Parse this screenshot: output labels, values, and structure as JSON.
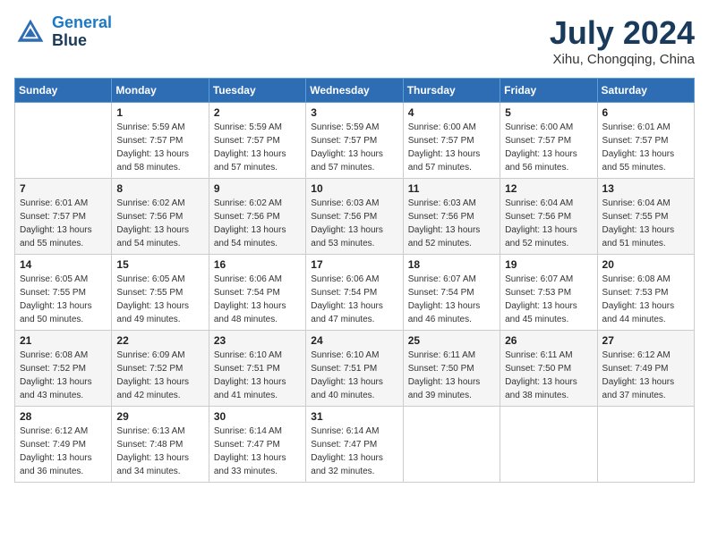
{
  "logo": {
    "line1": "General",
    "line2": "Blue"
  },
  "title": "July 2024",
  "location": "Xihu, Chongqing, China",
  "weekdays": [
    "Sunday",
    "Monday",
    "Tuesday",
    "Wednesday",
    "Thursday",
    "Friday",
    "Saturday"
  ],
  "weeks": [
    [
      {
        "day": "",
        "info": ""
      },
      {
        "day": "1",
        "info": "Sunrise: 5:59 AM\nSunset: 7:57 PM\nDaylight: 13 hours\nand 58 minutes."
      },
      {
        "day": "2",
        "info": "Sunrise: 5:59 AM\nSunset: 7:57 PM\nDaylight: 13 hours\nand 57 minutes."
      },
      {
        "day": "3",
        "info": "Sunrise: 5:59 AM\nSunset: 7:57 PM\nDaylight: 13 hours\nand 57 minutes."
      },
      {
        "day": "4",
        "info": "Sunrise: 6:00 AM\nSunset: 7:57 PM\nDaylight: 13 hours\nand 57 minutes."
      },
      {
        "day": "5",
        "info": "Sunrise: 6:00 AM\nSunset: 7:57 PM\nDaylight: 13 hours\nand 56 minutes."
      },
      {
        "day": "6",
        "info": "Sunrise: 6:01 AM\nSunset: 7:57 PM\nDaylight: 13 hours\nand 55 minutes."
      }
    ],
    [
      {
        "day": "7",
        "info": "Sunrise: 6:01 AM\nSunset: 7:57 PM\nDaylight: 13 hours\nand 55 minutes."
      },
      {
        "day": "8",
        "info": "Sunrise: 6:02 AM\nSunset: 7:56 PM\nDaylight: 13 hours\nand 54 minutes."
      },
      {
        "day": "9",
        "info": "Sunrise: 6:02 AM\nSunset: 7:56 PM\nDaylight: 13 hours\nand 54 minutes."
      },
      {
        "day": "10",
        "info": "Sunrise: 6:03 AM\nSunset: 7:56 PM\nDaylight: 13 hours\nand 53 minutes."
      },
      {
        "day": "11",
        "info": "Sunrise: 6:03 AM\nSunset: 7:56 PM\nDaylight: 13 hours\nand 52 minutes."
      },
      {
        "day": "12",
        "info": "Sunrise: 6:04 AM\nSunset: 7:56 PM\nDaylight: 13 hours\nand 52 minutes."
      },
      {
        "day": "13",
        "info": "Sunrise: 6:04 AM\nSunset: 7:55 PM\nDaylight: 13 hours\nand 51 minutes."
      }
    ],
    [
      {
        "day": "14",
        "info": "Sunrise: 6:05 AM\nSunset: 7:55 PM\nDaylight: 13 hours\nand 50 minutes."
      },
      {
        "day": "15",
        "info": "Sunrise: 6:05 AM\nSunset: 7:55 PM\nDaylight: 13 hours\nand 49 minutes."
      },
      {
        "day": "16",
        "info": "Sunrise: 6:06 AM\nSunset: 7:54 PM\nDaylight: 13 hours\nand 48 minutes."
      },
      {
        "day": "17",
        "info": "Sunrise: 6:06 AM\nSunset: 7:54 PM\nDaylight: 13 hours\nand 47 minutes."
      },
      {
        "day": "18",
        "info": "Sunrise: 6:07 AM\nSunset: 7:54 PM\nDaylight: 13 hours\nand 46 minutes."
      },
      {
        "day": "19",
        "info": "Sunrise: 6:07 AM\nSunset: 7:53 PM\nDaylight: 13 hours\nand 45 minutes."
      },
      {
        "day": "20",
        "info": "Sunrise: 6:08 AM\nSunset: 7:53 PM\nDaylight: 13 hours\nand 44 minutes."
      }
    ],
    [
      {
        "day": "21",
        "info": "Sunrise: 6:08 AM\nSunset: 7:52 PM\nDaylight: 13 hours\nand 43 minutes."
      },
      {
        "day": "22",
        "info": "Sunrise: 6:09 AM\nSunset: 7:52 PM\nDaylight: 13 hours\nand 42 minutes."
      },
      {
        "day": "23",
        "info": "Sunrise: 6:10 AM\nSunset: 7:51 PM\nDaylight: 13 hours\nand 41 minutes."
      },
      {
        "day": "24",
        "info": "Sunrise: 6:10 AM\nSunset: 7:51 PM\nDaylight: 13 hours\nand 40 minutes."
      },
      {
        "day": "25",
        "info": "Sunrise: 6:11 AM\nSunset: 7:50 PM\nDaylight: 13 hours\nand 39 minutes."
      },
      {
        "day": "26",
        "info": "Sunrise: 6:11 AM\nSunset: 7:50 PM\nDaylight: 13 hours\nand 38 minutes."
      },
      {
        "day": "27",
        "info": "Sunrise: 6:12 AM\nSunset: 7:49 PM\nDaylight: 13 hours\nand 37 minutes."
      }
    ],
    [
      {
        "day": "28",
        "info": "Sunrise: 6:12 AM\nSunset: 7:49 PM\nDaylight: 13 hours\nand 36 minutes."
      },
      {
        "day": "29",
        "info": "Sunrise: 6:13 AM\nSunset: 7:48 PM\nDaylight: 13 hours\nand 34 minutes."
      },
      {
        "day": "30",
        "info": "Sunrise: 6:14 AM\nSunset: 7:47 PM\nDaylight: 13 hours\nand 33 minutes."
      },
      {
        "day": "31",
        "info": "Sunrise: 6:14 AM\nSunset: 7:47 PM\nDaylight: 13 hours\nand 32 minutes."
      },
      {
        "day": "",
        "info": ""
      },
      {
        "day": "",
        "info": ""
      },
      {
        "day": "",
        "info": ""
      }
    ]
  ]
}
